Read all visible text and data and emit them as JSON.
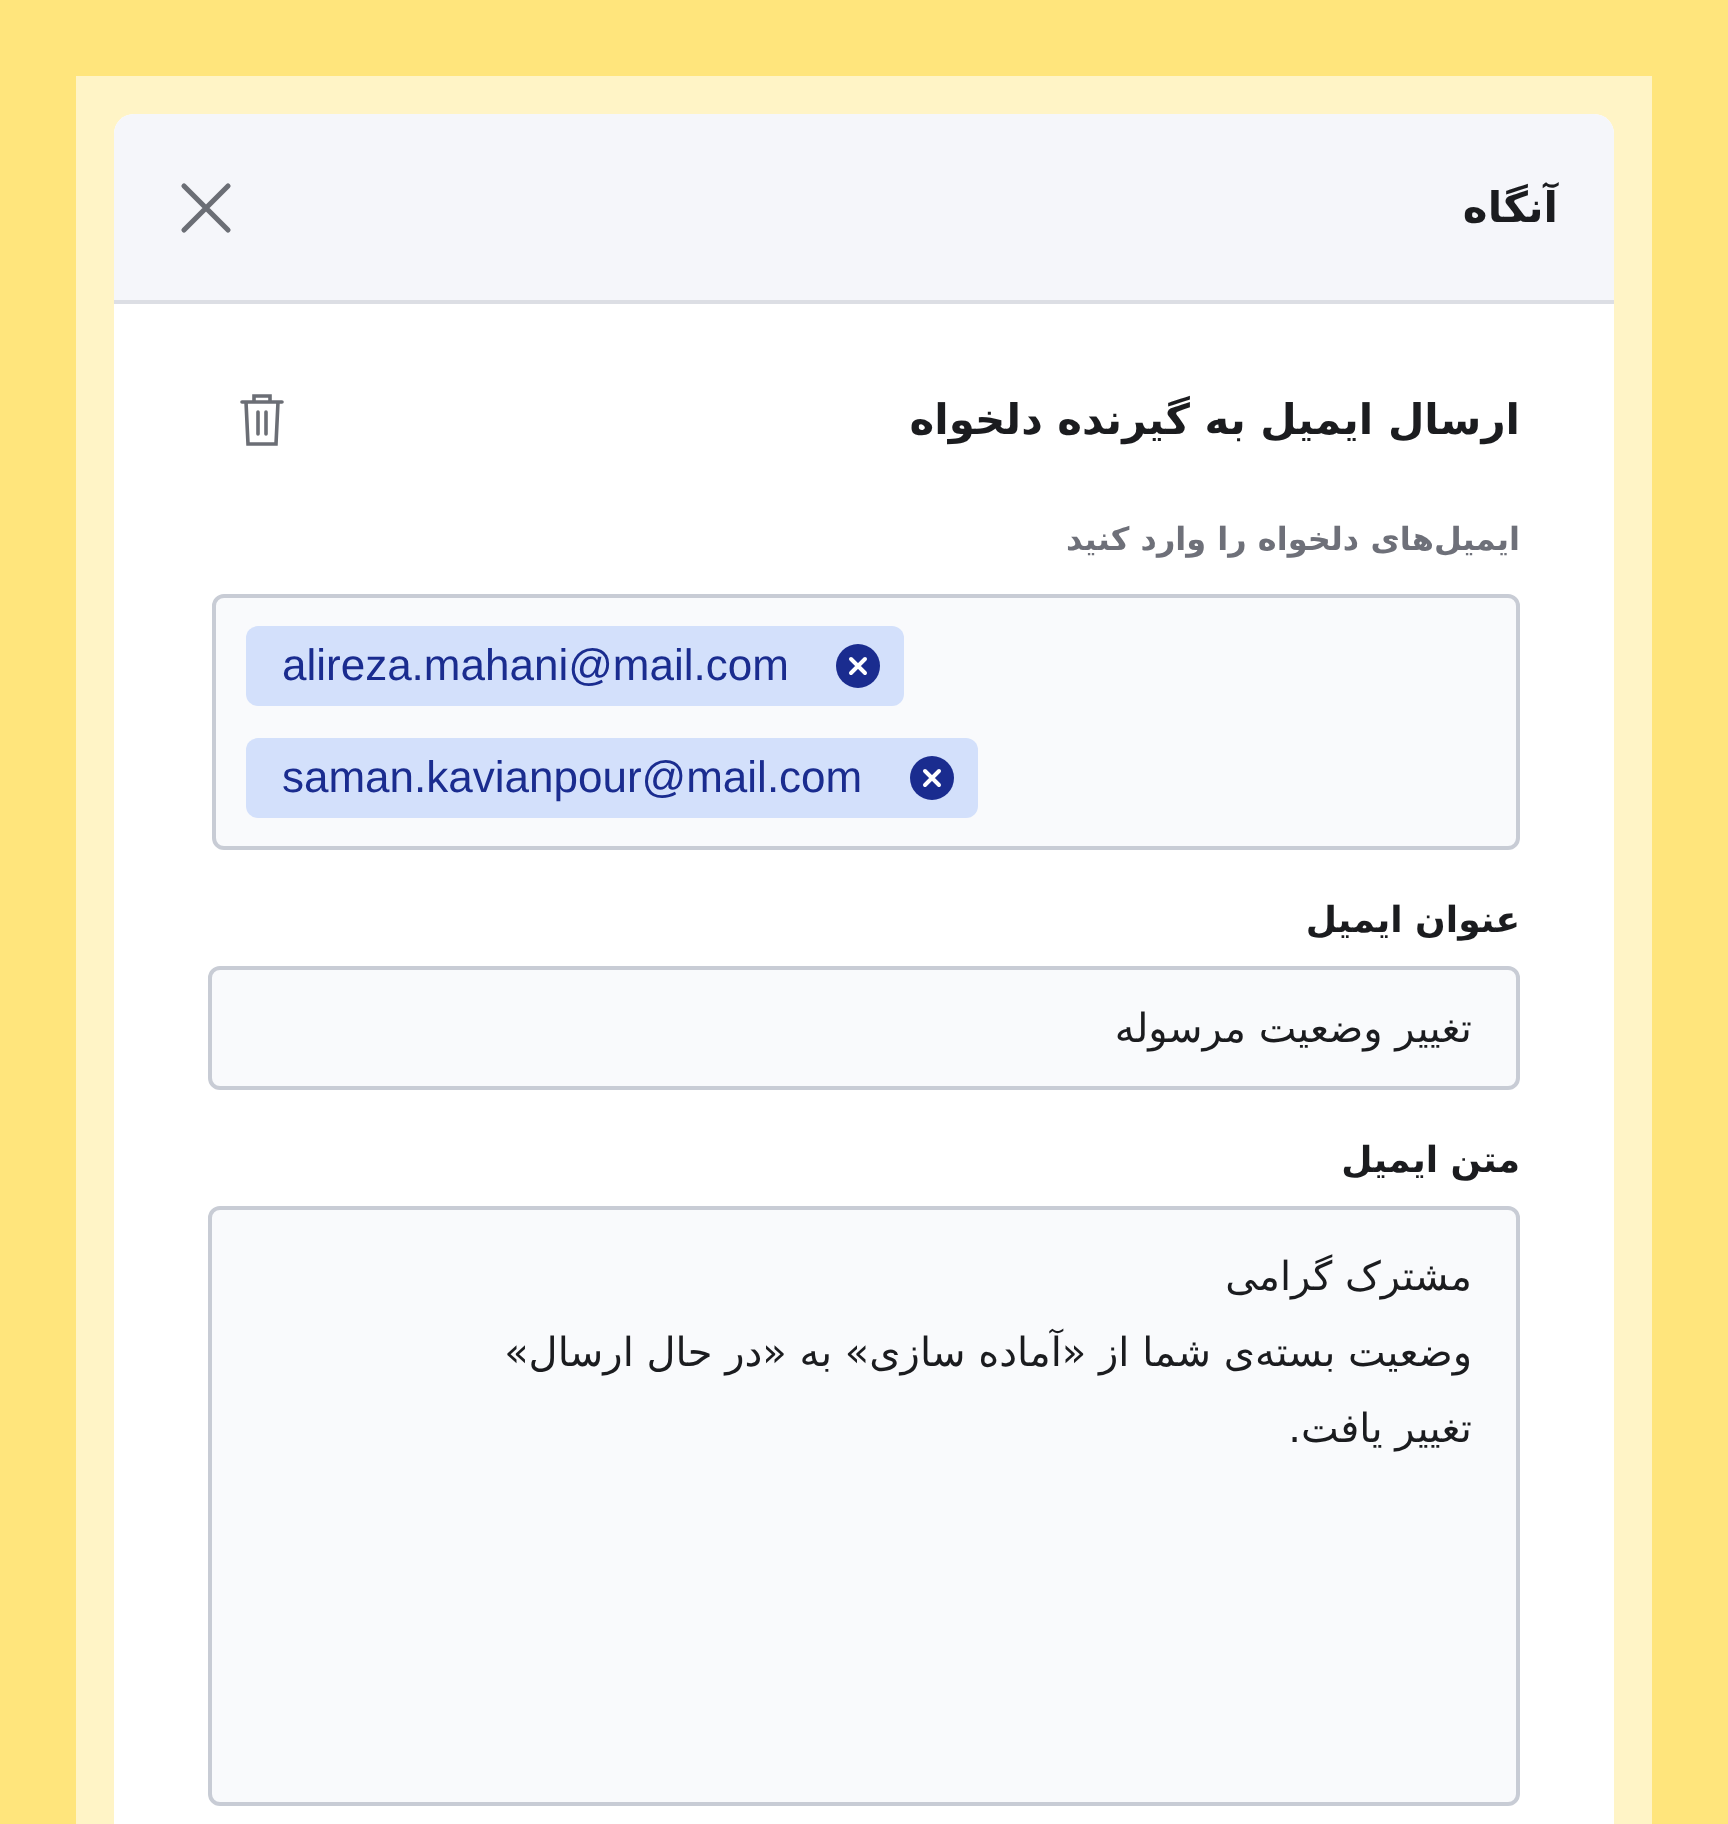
{
  "dialog": {
    "title": "آنگاه"
  },
  "section": {
    "title": "ارسال ایمیل به گیرنده دلخواه"
  },
  "recipients": {
    "label": "ایمیل‌های دلخواه را وارد کنید",
    "chips": [
      {
        "text": "alireza.mahani@mail.com"
      },
      {
        "text": "saman.kavianpour@mail.com"
      }
    ]
  },
  "subject": {
    "label": "عنوان ایمیل",
    "value": "تغییر وضعیت مرسوله"
  },
  "body": {
    "label": "متن ایمیل",
    "lines": [
      "مشترک گرامی",
      "وضعیت بسته‌ی شما از «آماده سازی» به «در حال ارسال»",
      "تغییر یافت."
    ]
  }
}
